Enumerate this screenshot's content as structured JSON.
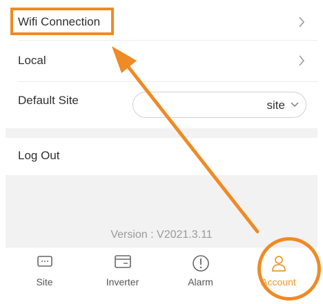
{
  "settings": {
    "wifi_label": "Wifi Connection",
    "local_label": "Local",
    "default_site_label": "Default Site",
    "default_site_value": "site",
    "logout_label": "Log Out",
    "version_text": "Version : V2021.3.11"
  },
  "tabs": [
    {
      "label": "Site",
      "icon": "site-icon"
    },
    {
      "label": "Inverter",
      "icon": "inverter-icon"
    },
    {
      "label": "Alarm",
      "icon": "alarm-icon"
    },
    {
      "label": "Account",
      "icon": "account-icon",
      "active": true
    }
  ],
  "colors": {
    "highlight": "#f08a24",
    "active_tab": "#e89a2c",
    "background_grey": "#f2f2f2"
  }
}
